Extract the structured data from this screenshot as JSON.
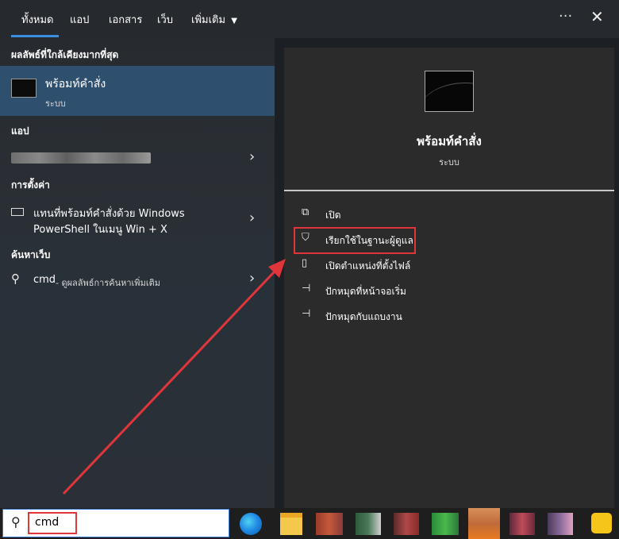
{
  "tabs": [
    {
      "label": "ทั้งหมด"
    },
    {
      "label": "แอป"
    },
    {
      "label": "เอกสาร"
    },
    {
      "label": "เว็บ"
    },
    {
      "label": "เพิ่มเติม"
    }
  ],
  "window": {
    "more_icon": "ellipsis-icon",
    "close_icon": "close-icon"
  },
  "left": {
    "best_match_header": "ผลลัพธ์ที่ใกล้เคียงมากที่สุด",
    "best_match": {
      "title": "พร้อมท์คำสั่ง",
      "subtitle": "ระบบ"
    },
    "apps_header": "แอป",
    "settings_header": "การตั้งค่า",
    "settings_item": {
      "line1": "แทนที่พร้อมท์คำสั่งด้วย Windows",
      "line2": "PowerShell ในเมนู Win + X"
    },
    "web_header": "ค้นหาเว็บ",
    "web_item": {
      "query": "cmd",
      "hint": " - ดูผลลัพธ์การค้นหาเพิ่มเติม"
    }
  },
  "right": {
    "app_title": "พร้อมท์คำสั่ง",
    "app_subtitle": "ระบบ",
    "actions": [
      {
        "label": "เปิด",
        "icon": "open-icon"
      },
      {
        "label": "เรียกใช้ในฐานะผู้ดูแล",
        "icon": "shield-icon"
      },
      {
        "label": "เปิดตำแหน่งที่ตั้งไฟล์",
        "icon": "file-location-icon"
      },
      {
        "label": "ปักหมุดที่หน้าจอเริ่ม",
        "icon": "pin-icon"
      },
      {
        "label": "ปักหมุดกับแถบงาน",
        "icon": "pin-icon"
      }
    ]
  },
  "taskbar": {
    "search_value": "cmd"
  },
  "colors": {
    "accent": "#3a8fe0",
    "highlight": "#e0353b",
    "selected": "#2f4f6e"
  }
}
